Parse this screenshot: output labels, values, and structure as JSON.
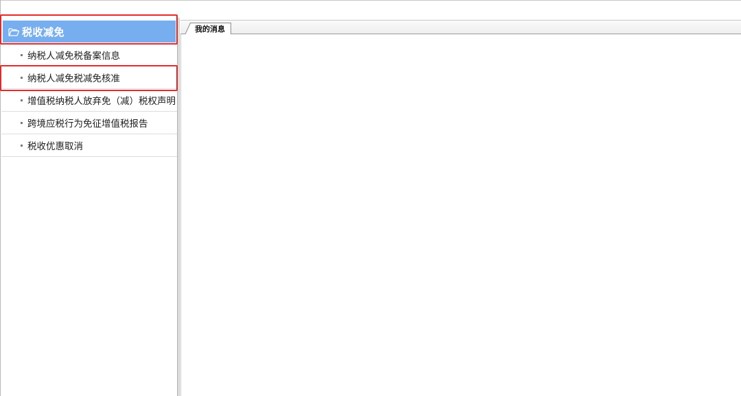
{
  "sidebar": {
    "header": {
      "title": "税收减免",
      "icon": "folder-open-icon"
    },
    "items": [
      {
        "label": "纳税人减免税备案信息"
      },
      {
        "label": "纳税人减免税减免核准"
      },
      {
        "label": "增值税纳税人放弃免（减）税权声明"
      },
      {
        "label": "跨境应税行为免征增值税报告"
      },
      {
        "label": "税收优惠取消"
      }
    ]
  },
  "main": {
    "tabs": [
      {
        "label": "我的消息"
      }
    ]
  },
  "colors": {
    "header_bg": "#76aef0",
    "highlight_border": "#e3292a"
  }
}
